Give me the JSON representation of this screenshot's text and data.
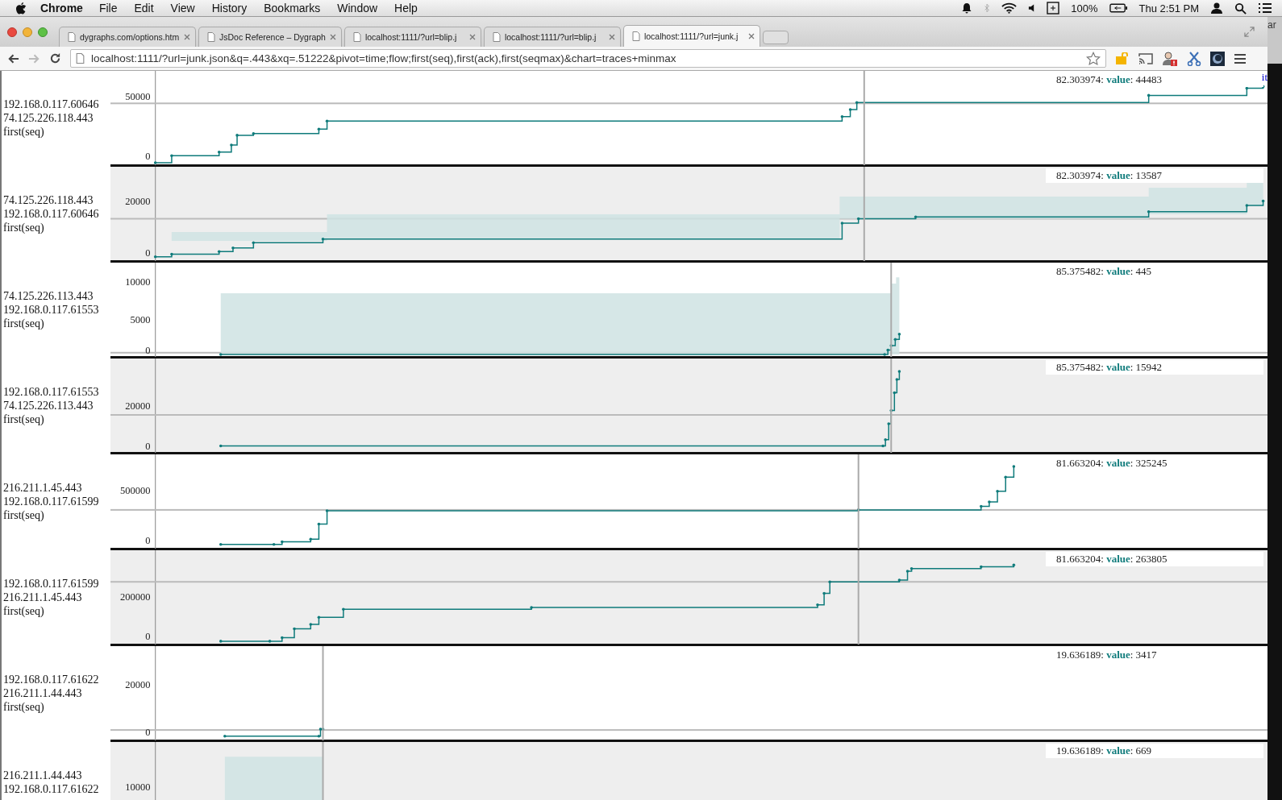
{
  "menu_bar": {
    "app": "Chrome",
    "menus": [
      "File",
      "Edit",
      "View",
      "History",
      "Bookmarks",
      "Window",
      "Help"
    ],
    "battery": "100%",
    "clock": "Thu 2:51 PM"
  },
  "tabs": [
    {
      "title": "dygraphs.com/options.htm",
      "selected": false
    },
    {
      "title": "JsDoc Reference – Dygraph",
      "selected": false
    },
    {
      "title": "localhost:1111/?url=blip.j",
      "selected": false
    },
    {
      "title": "localhost:1111/?url=blip.j",
      "selected": false
    },
    {
      "title": "localhost:1111/?url=junk.j",
      "selected": true
    }
  ],
  "background_window_text": "ar",
  "address_bar": {
    "url": "localhost:1111/?url=junk.json&q=.443&xq=.51222&pivot=time;flow;first(seq),first(ack),first(seqmax)&chart=traces+minmax"
  },
  "charts": [
    {
      "labels": [
        "192.168.0.117.60646",
        "74.125.226.118.443",
        "first(seq)"
      ],
      "ticks": [
        "50000",
        "0"
      ],
      "legend": "82.303974: **value**: 44483",
      "minmax_band": false,
      "corner_link": "it"
    },
    {
      "labels": [
        "74.125.226.118.443",
        "192.168.0.117.60646",
        "first(seq)"
      ],
      "ticks": [
        "20000",
        "0"
      ],
      "legend": "82.303974: **value**: 13587",
      "minmax_band": true
    },
    {
      "labels": [
        "74.125.226.113.443",
        "192.168.0.117.61553",
        "first(seq)"
      ],
      "ticks": [
        "10000",
        "5000",
        "0"
      ],
      "legend": "85.375482: **value**: 445",
      "minmax_band": true
    },
    {
      "labels": [
        "192.168.0.117.61553",
        "74.125.226.113.443",
        "first(seq)"
      ],
      "ticks": [
        "20000",
        "0"
      ],
      "legend": "85.375482: **value**: 15942",
      "minmax_band": false
    },
    {
      "labels": [
        "216.211.1.45.443",
        "192.168.0.117.61599",
        "first(seq)"
      ],
      "ticks": [
        "500000",
        "0"
      ],
      "legend": "81.663204: **value**: 325245",
      "minmax_band": false
    },
    {
      "labels": [
        "192.168.0.117.61599",
        "216.211.1.45.443",
        "first(seq)"
      ],
      "ticks": [
        "200000",
        "0"
      ],
      "legend": "81.663204: **value**: 263805",
      "minmax_band": false
    },
    {
      "labels": [
        "192.168.0.117.61622",
        "216.211.1.44.443",
        "first(seq)"
      ],
      "ticks": [
        "20000",
        "0"
      ],
      "legend": "19.636189: **value**: 3417",
      "minmax_band": false
    },
    {
      "labels": [
        "216.211.1.44.443",
        "192.168.0.117.61622"
      ],
      "ticks": [
        "10000"
      ],
      "legend": "19.636189: **value**: 669",
      "minmax_band": true
    }
  ]
}
